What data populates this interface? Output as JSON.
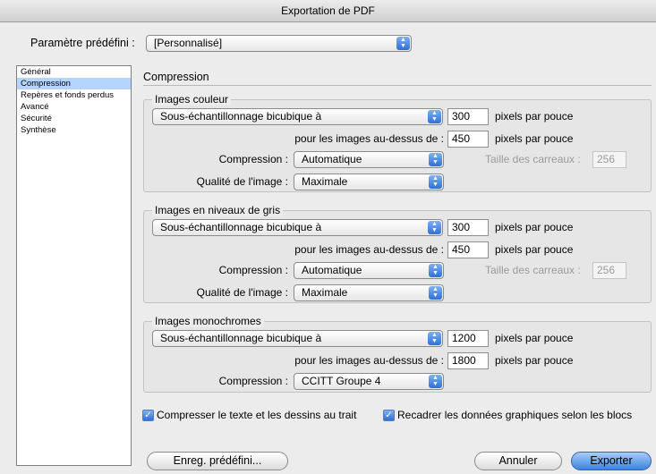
{
  "window": {
    "title": "Exportation de PDF"
  },
  "preset": {
    "label": "Paramètre prédéfini :",
    "value": "[Personnalisé]"
  },
  "sidebar": {
    "items": [
      {
        "label": "Général"
      },
      {
        "label": "Compression"
      },
      {
        "label": "Repères et fonds perdus"
      },
      {
        "label": "Avancé"
      },
      {
        "label": "Sécurité"
      },
      {
        "label": "Synthèse"
      }
    ]
  },
  "section": {
    "title": "Compression"
  },
  "color": {
    "title": "Images couleur",
    "sampling": "Sous-échantillonnage bicubique à",
    "ppi": "300",
    "ppi_unit": "pixels par pouce",
    "above_label": "pour les images au-dessus de :",
    "above": "450",
    "above_unit": "pixels par pouce",
    "compression_label": "Compression :",
    "compression": "Automatique",
    "tile_label": "Taille des carreaux :",
    "tile": "256",
    "quality_label": "Qualité de l'image :",
    "quality": "Maximale"
  },
  "gray": {
    "title": "Images en niveaux de gris",
    "sampling": "Sous-échantillonnage bicubique à",
    "ppi": "300",
    "ppi_unit": "pixels par pouce",
    "above_label": "pour les images au-dessus de :",
    "above": "450",
    "above_unit": "pixels par pouce",
    "compression_label": "Compression :",
    "compression": "Automatique",
    "tile_label": "Taille des carreaux :",
    "tile": "256",
    "quality_label": "Qualité de l'image :",
    "quality": "Maximale"
  },
  "mono": {
    "title": "Images monochromes",
    "sampling": "Sous-échantillonnage bicubique à",
    "ppi": "1200",
    "ppi_unit": "pixels par pouce",
    "above_label": "pour les images au-dessus de :",
    "above": "1800",
    "above_unit": "pixels par pouce",
    "compression_label": "Compression :",
    "compression": "CCITT Groupe 4"
  },
  "options": {
    "compress_text": "Compresser le texte et les dessins au trait",
    "compress_text_checked": true,
    "crop": "Recadrer les données graphiques selon les blocs",
    "crop_checked": true
  },
  "buttons": {
    "save_preset": "Enreg. prédéfini...",
    "cancel": "Annuler",
    "export": "Exporter"
  }
}
